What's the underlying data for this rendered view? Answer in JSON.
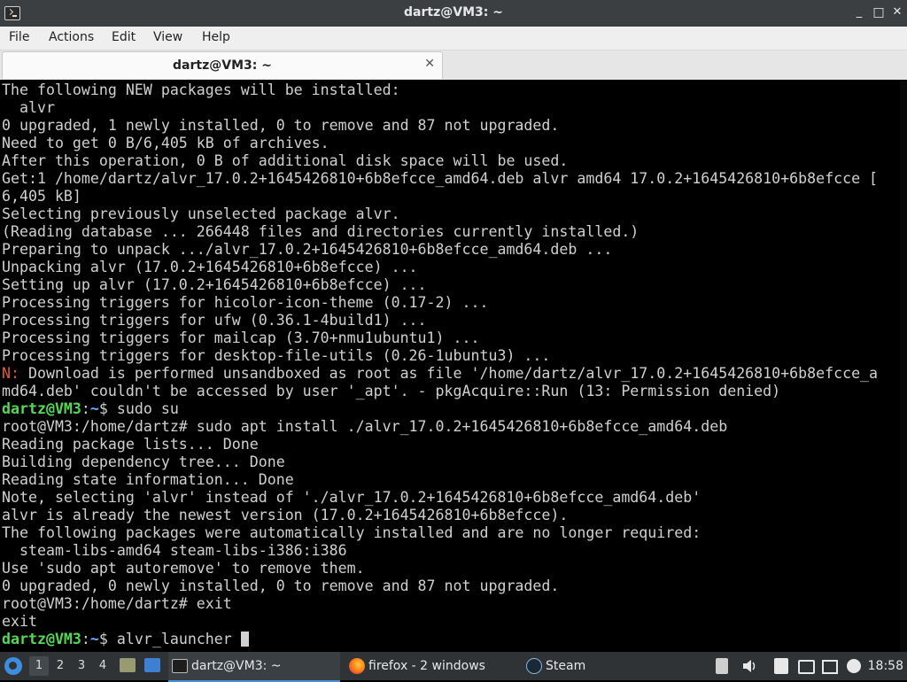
{
  "window": {
    "title": "dartz@VM3: ~",
    "controls": {
      "minimize": "_",
      "maximize": "□",
      "close": "✕"
    }
  },
  "menubar": {
    "items": [
      "File",
      "Actions",
      "Edit",
      "View",
      "Help"
    ]
  },
  "tab": {
    "label": "dartz@VM3: ~",
    "close_glyph": "✕"
  },
  "terminal": {
    "lines": [
      {
        "t": "The following NEW packages will be installed:"
      },
      {
        "t": "  alvr"
      },
      {
        "t": "0 upgraded, 1 newly installed, 0 to remove and 87 not upgraded."
      },
      {
        "t": "Need to get 0 B/6,405 kB of archives."
      },
      {
        "t": "After this operation, 0 B of additional disk space will be used."
      },
      {
        "t": "Get:1 /home/dartz/alvr_17.0.2+1645426810+6b8efcce_amd64.deb alvr amd64 17.0.2+1645426810+6b8efcce ["
      },
      {
        "t": "6,405 kB]"
      },
      {
        "t": "Selecting previously unselected package alvr."
      },
      {
        "t": "(Reading database ... 266448 files and directories currently installed.)"
      },
      {
        "t": "Preparing to unpack .../alvr_17.0.2+1645426810+6b8efcce_amd64.deb ..."
      },
      {
        "t": "Unpacking alvr (17.0.2+1645426810+6b8efcce) ..."
      },
      {
        "t": "Setting up alvr (17.0.2+1645426810+6b8efcce) ..."
      },
      {
        "t": "Processing triggers for hicolor-icon-theme (0.17-2) ..."
      },
      {
        "t": "Processing triggers for ufw (0.36.1-4build1) ..."
      },
      {
        "t": "Processing triggers for mailcap (3.70+nmu1ubuntu1) ..."
      },
      {
        "t": "Processing triggers for desktop-file-utils (0.26-1ubuntu3) ..."
      },
      {
        "notice": "N:",
        "t": " Download is performed unsandboxed as root as file '/home/dartz/alvr_17.0.2+1645426810+6b8efcce_a"
      },
      {
        "t": "md64.deb' couldn't be accessed by user '_apt'. - pkgAcquire::Run (13: Permission denied)"
      },
      {
        "user": "dartz@VM3",
        "path": "~",
        "cmd": "$ sudo su"
      },
      {
        "t": "root@VM3:/home/dartz# sudo apt install ./alvr_17.0.2+1645426810+6b8efcce_amd64.deb"
      },
      {
        "t": "Reading package lists... Done"
      },
      {
        "t": "Building dependency tree... Done"
      },
      {
        "t": "Reading state information... Done"
      },
      {
        "t": "Note, selecting 'alvr' instead of './alvr_17.0.2+1645426810+6b8efcce_amd64.deb'"
      },
      {
        "t": "alvr is already the newest version (17.0.2+1645426810+6b8efcce)."
      },
      {
        "t": "The following packages were automatically installed and are no longer required:"
      },
      {
        "t": "  steam-libs-amd64 steam-libs-i386:i386"
      },
      {
        "t": "Use 'sudo apt autoremove' to remove them."
      },
      {
        "t": "0 upgraded, 0 newly installed, 0 to remove and 87 not upgraded."
      },
      {
        "t": "root@VM3:/home/dartz# exit"
      },
      {
        "t": "exit"
      },
      {
        "user": "dartz@VM3",
        "path": "~",
        "cmd": "$ alvr_launcher ",
        "cursor": true
      }
    ]
  },
  "taskbar": {
    "workspaces": [
      "1",
      "2",
      "3",
      "4"
    ],
    "active_workspace": "1",
    "tasks": [
      {
        "label": "dartz@VM3: ~",
        "icon": "terminal-icon",
        "active": true
      },
      {
        "label": "firefox - 2 windows",
        "icon": "firefox-icon",
        "active": false
      },
      {
        "label": "Steam",
        "icon": "steam-icon",
        "active": false
      }
    ],
    "clock": "18:58"
  },
  "colors": {
    "user_prompt": "#55d855",
    "path_prompt": "#6fa8ff",
    "notice": "#e05c2a",
    "terminal_fg": "#d0d0d0",
    "terminal_bg": "#000000",
    "accent": "#4a90d9"
  }
}
